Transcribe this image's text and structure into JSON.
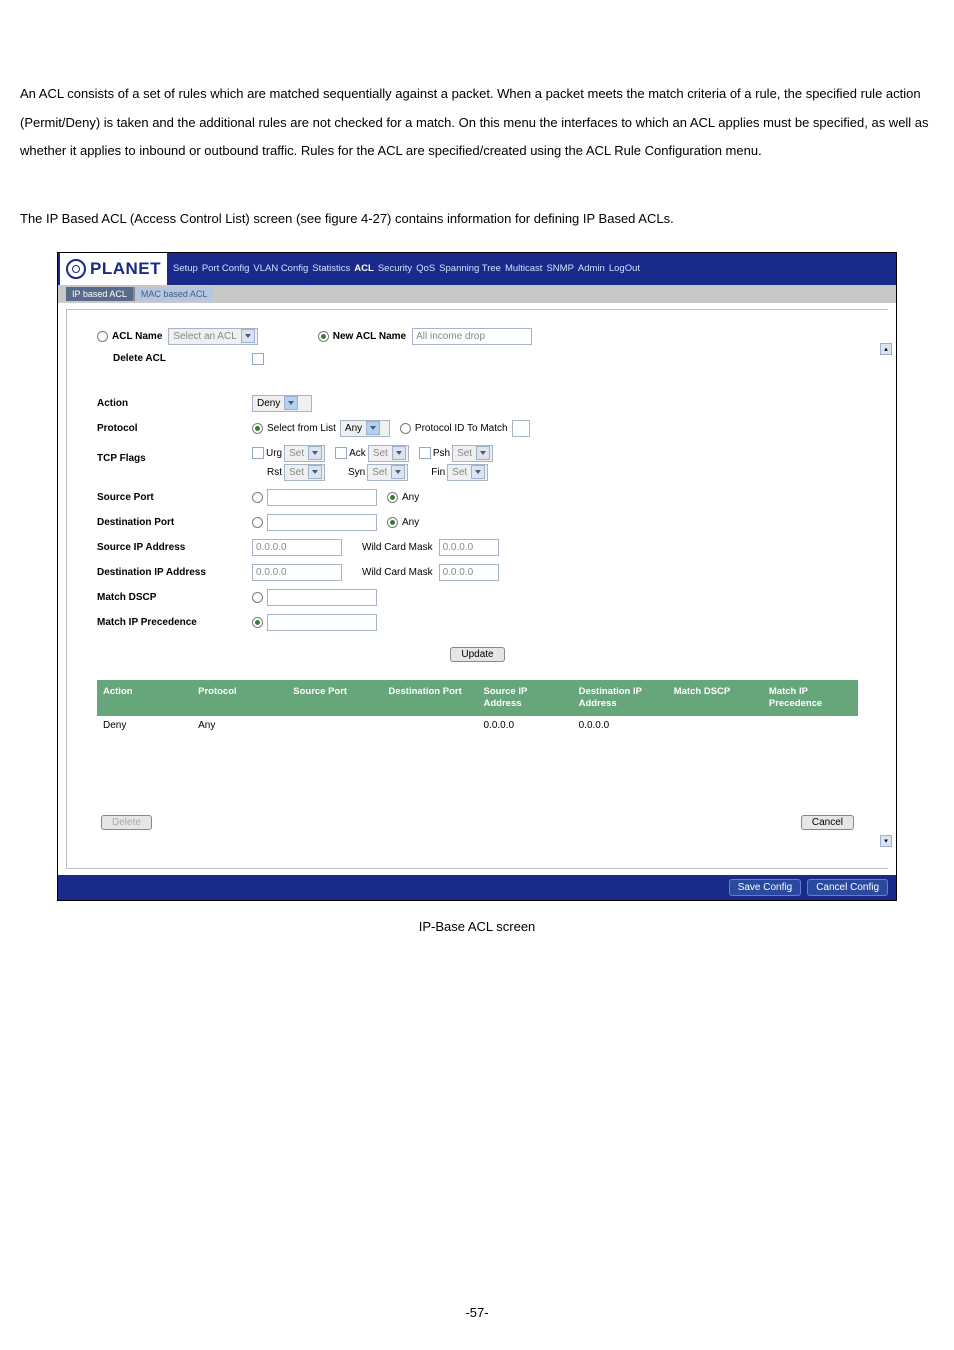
{
  "intro": "An ACL consists of a set of rules which are matched sequentially against a packet. When a packet meets the match criteria of a rule, the specified rule action (Permit/Deny) is taken and the additional rules are not checked for a match. On this menu the interfaces to which an ACL applies must be specified, as well as whether it applies to inbound or outbound traffic. Rules for the ACL are specified/created using the ACL Rule Configuration menu.",
  "subintro": "The IP Based ACL (Access Control List) screen (see figure 4-27) contains information for defining IP Based ACLs.",
  "logo_text": "PLANET",
  "nav_items": [
    "Setup",
    "Port Config",
    "VLAN Config",
    "Statistics",
    "ACL",
    "Security",
    "QoS",
    "Spanning Tree",
    "Multicast",
    "SNMP",
    "Admin",
    "LogOut"
  ],
  "nav_active": "ACL",
  "tabs": {
    "ip": "IP based ACL",
    "mac": "MAC based ACL"
  },
  "acl_name_label": "ACL Name",
  "acl_name_select": "Select an ACL",
  "new_acl_label": "New ACL Name",
  "new_acl_value": "All income drop",
  "delete_acl_label": "Delete ACL",
  "form": {
    "action": {
      "label": "Action",
      "value": "Deny"
    },
    "protocol": {
      "label": "Protocol",
      "select_label": "Select from List",
      "select_value": "Any",
      "proto_id_label": "Protocol ID To Match"
    },
    "tcp": {
      "label": "TCP Flags",
      "urg": "Urg",
      "rst": "Rst",
      "ack": "Ack",
      "syn": "Syn",
      "psh": "Psh",
      "fin": "Fin",
      "set": "Set"
    },
    "src_port": {
      "label": "Source Port",
      "any": "Any"
    },
    "dst_port": {
      "label": "Destination Port",
      "any": "Any"
    },
    "src_ip": {
      "label": "Source IP Address",
      "value": "0.0.0.0",
      "mask_label": "Wild Card Mask",
      "mask": "0.0.0.0"
    },
    "dst_ip": {
      "label": "Destination IP Address",
      "value": "0.0.0.0",
      "mask_label": "Wild Card Mask",
      "mask": "0.0.0.0"
    },
    "dscp": {
      "label": "Match DSCP"
    },
    "ipprec": {
      "label": "Match IP Precedence"
    }
  },
  "update_btn": "Update",
  "table": {
    "headers": [
      "Action",
      "Protocol",
      "Source Port",
      "Destination Port",
      "Source IP Address",
      "Destination IP Address",
      "Match DSCP",
      "Match IP Precedence"
    ],
    "row": {
      "action": "Deny",
      "protocol": "Any",
      "src_port": "",
      "dst_port": "",
      "src_ip": "0.0.0.0",
      "dst_ip": "0.0.0.0",
      "match_dscp": "",
      "match_prec": ""
    }
  },
  "delete_btn": "Delete",
  "cancel_btn": "Cancel",
  "save_config": "Save Config",
  "cancel_config": "Cancel Config",
  "caption": "IP-Base ACL screen",
  "page_number": "-57-"
}
